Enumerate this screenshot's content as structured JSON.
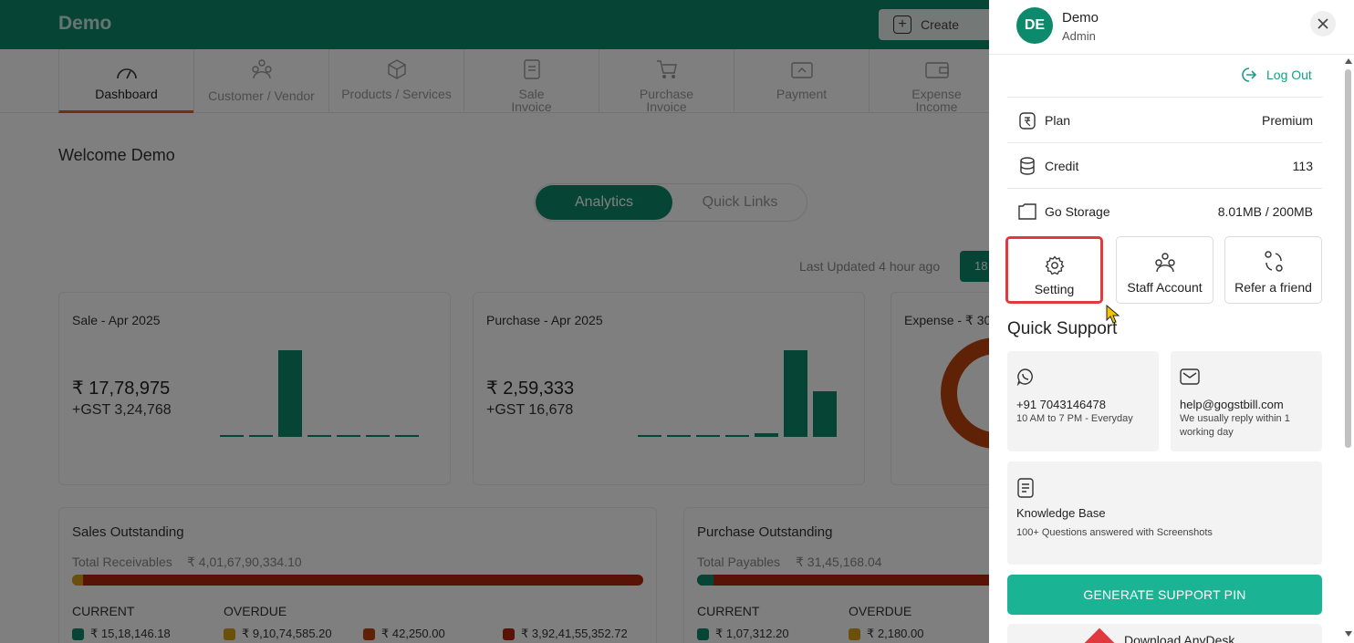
{
  "app": {
    "brand": "Demo",
    "create_label": "Create"
  },
  "nav": {
    "items": [
      {
        "label": "Dashboard",
        "icon": "gauge-icon"
      },
      {
        "label": "Customer / Vendor",
        "icon": "people-icon"
      },
      {
        "label": "Products / Services",
        "icon": "box-icon"
      },
      {
        "label": "Sale Invoice",
        "icon": "invoice-icon"
      },
      {
        "label": "Purchase Invoice",
        "icon": "cart-icon"
      },
      {
        "label": "Payment",
        "icon": "payment-icon"
      },
      {
        "label": "Expense Income",
        "icon": "wallet-icon"
      }
    ]
  },
  "dashboard": {
    "welcome": "Welcome Demo",
    "tabs": {
      "analytics": "Analytics",
      "quick_links": "Quick Links"
    },
    "last_updated": "Last Updated 4 hour ago",
    "range_button": "18",
    "sale": {
      "title": "Sale - Apr 2025",
      "amount": "₹ 17,78,975",
      "gst": "+GST 3,24,768",
      "bars": [
        1,
        1,
        90,
        1,
        1,
        0,
        1
      ]
    },
    "purchase": {
      "title": "Purchase - Apr 2025",
      "amount": "₹ 2,59,333",
      "gst": "+GST 16,678",
      "bars": [
        1,
        1,
        1,
        1,
        4,
        88,
        46
      ]
    },
    "expense": {
      "title": "Expense - ₹ 30"
    },
    "sales_outstanding": {
      "title": "Sales Outstanding",
      "total_label": "Total Receivables",
      "total_value": "₹ 4,01,67,90,334.10",
      "current_label": "CURRENT",
      "overdue_label": "OVERDUE",
      "current_value": "₹ 15,18,146.18",
      "overdue_values": [
        "₹ 9,10,74,585.20",
        "₹ 42,250.00",
        "₹ 3,92,41,55,352.72"
      ]
    },
    "purchase_outstanding": {
      "title": "Purchase Outstanding",
      "total_label": "Total Payables",
      "total_value": "₹ 31,45,168.04",
      "current_label": "CURRENT",
      "overdue_label": "OVERDUE",
      "current_value": "₹ 1,07,312.20",
      "overdue_values": [
        "₹ 2,180.00"
      ]
    },
    "colors": {
      "primary": "#0d8a6c",
      "overdue_1": "#d4a017",
      "overdue_2": "#c0440f",
      "overdue_3": "#b3270c"
    }
  },
  "drawer": {
    "avatar": "DE",
    "user_name": "Demo",
    "user_role": "Admin",
    "logout": "Log Out",
    "rows": [
      {
        "label": "Plan",
        "value": "Premium",
        "icon": "rupee-icon"
      },
      {
        "label": "Credit",
        "value": "113",
        "icon": "coins-icon"
      },
      {
        "label": "Go Storage",
        "value": "8.01MB / 200MB",
        "icon": "folder-icon"
      }
    ],
    "tiles": [
      {
        "label": "Setting",
        "icon": "gear-icon"
      },
      {
        "label": "Staff Account",
        "icon": "staff-icon"
      },
      {
        "label": "Refer a friend",
        "icon": "refer-icon"
      }
    ],
    "quick_support": {
      "title": "Quick Support",
      "phone": "+91 7043146478",
      "phone_hours": "10 AM to 7 PM - Everyday",
      "email": "help@gogstbill.com",
      "email_note": "We usually reply within 1 working day",
      "kb_title": "Knowledge Base",
      "kb_note": "100+ Questions answered with Screenshots"
    },
    "pin_button": "GENERATE SUPPORT PIN",
    "anydesk": "Download AnyDesk"
  }
}
